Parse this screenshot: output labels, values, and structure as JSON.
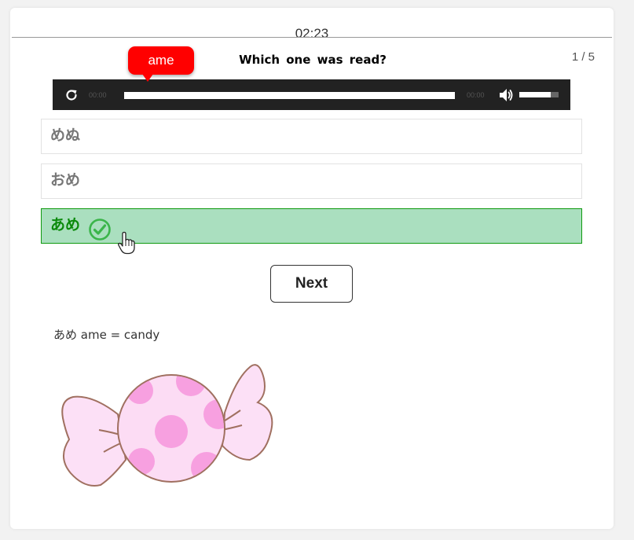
{
  "timer": "02:23",
  "progress": "1 / 5",
  "question": "Which one was read?",
  "tooltip": "ame",
  "player": {
    "time_current": "00:00",
    "time_total": "00:00",
    "volume_fraction": 0.8
  },
  "options": [
    {
      "label": "めぬ",
      "state": "default"
    },
    {
      "label": "おめ",
      "state": "default"
    },
    {
      "label": "あめ",
      "state": "correct"
    }
  ],
  "next_label": "Next",
  "vocab": "あめ ame = candy",
  "colors": {
    "tooltip": "#ff0000",
    "correct_bg": "#aadfbf",
    "correct_border": "#109a10",
    "correct_text": "#0b8a0b",
    "player_bg": "#222222"
  },
  "icons": [
    "reload-icon",
    "volume-icon",
    "check-circle-icon",
    "hand-pointer-icon",
    "candy-illustration"
  ]
}
